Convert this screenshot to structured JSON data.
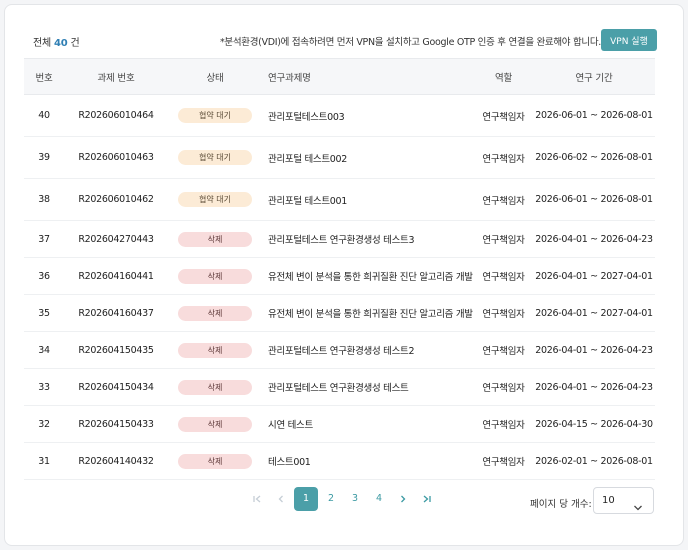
{
  "header": {
    "total_prefix": "전체",
    "total_count": "40",
    "total_suffix": "건",
    "notice": "*분석환경(VDI)에 접속하려면 먼저 VPN을 설치하고 Google OTP 인증 후 연결을 완료해야 합니다.",
    "vpn_button": "VPN 실행"
  },
  "table": {
    "columns": [
      "번호",
      "과제 번호",
      "상태",
      "연구과제명",
      "역할",
      "연구 기간"
    ],
    "rows": [
      {
        "no": "40",
        "project_no": "R202606010464",
        "status": "협약 대기",
        "status_type": "pending",
        "name": "관리포털테스트003",
        "role": "연구책임자",
        "period": "2026-06-01 ~ 2026-08-01"
      },
      {
        "no": "39",
        "project_no": "R202606010463",
        "status": "협약 대기",
        "status_type": "pending",
        "name": "관리포털 테스트002",
        "role": "연구책임자",
        "period": "2026-06-02 ~ 2026-08-01"
      },
      {
        "no": "38",
        "project_no": "R202606010462",
        "status": "협약 대기",
        "status_type": "pending",
        "name": "관리포털 테스트001",
        "role": "연구책임자",
        "period": "2026-06-01 ~ 2026-08-01"
      },
      {
        "no": "37",
        "project_no": "R202604270443",
        "status": "삭제",
        "status_type": "deleted",
        "name": "관리포털테스트 연구환경생성 테스트3",
        "role": "연구책임자",
        "period": "2026-04-01 ~ 2026-04-23"
      },
      {
        "no": "36",
        "project_no": "R202604160441",
        "status": "삭제",
        "status_type": "deleted",
        "name": "유전체 변이 분석을 통한 희귀질환 진단 알고리즘 개발",
        "role": "연구책임자",
        "period": "2026-04-01 ~ 2027-04-01"
      },
      {
        "no": "35",
        "project_no": "R202604160437",
        "status": "삭제",
        "status_type": "deleted",
        "name": "유전체 변이 분석을 통한 희귀질환 진단 알고리즘 개발",
        "role": "연구책임자",
        "period": "2026-04-01 ~ 2027-04-01"
      },
      {
        "no": "34",
        "project_no": "R202604150435",
        "status": "삭제",
        "status_type": "deleted",
        "name": "관리포털테스트 연구환경생성 테스트2",
        "role": "연구책임자",
        "period": "2026-04-01 ~ 2026-04-23"
      },
      {
        "no": "33",
        "project_no": "R202604150434",
        "status": "삭제",
        "status_type": "deleted",
        "name": "관리포털테스트 연구환경생성 테스트",
        "role": "연구책임자",
        "period": "2026-04-01 ~ 2026-04-23"
      },
      {
        "no": "32",
        "project_no": "R202604150433",
        "status": "삭제",
        "status_type": "deleted",
        "name": "시연 테스트",
        "role": "연구책임자",
        "period": "2026-04-15 ~ 2026-04-30"
      },
      {
        "no": "31",
        "project_no": "R202604140432",
        "status": "삭제",
        "status_type": "deleted",
        "name": "테스트001",
        "role": "연구책임자",
        "period": "2026-02-01 ~ 2026-08-01"
      }
    ]
  },
  "pagination": {
    "pages": [
      "1",
      "2",
      "3",
      "4"
    ],
    "current": "1",
    "per_page_label": "페이지 당 개수:",
    "per_page_value": "10"
  },
  "colors": {
    "accent": "#4b9fa8",
    "count": "#2f7fb4",
    "pending_badge": "#fcebd6",
    "deleted_badge": "#f8dcdc"
  },
  "icons": {
    "first": "first-page-icon",
    "prev": "prev-page-icon",
    "next": "next-page-icon",
    "last": "last-page-icon",
    "select": "chevron-down-icon"
  }
}
